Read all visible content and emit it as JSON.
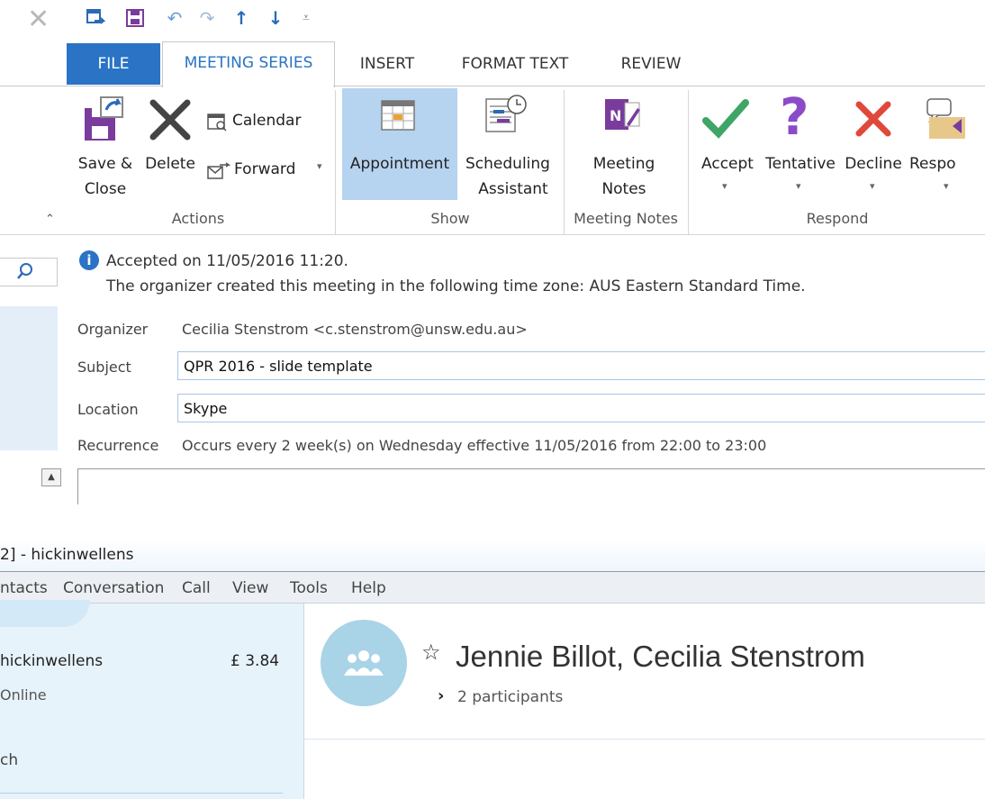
{
  "outlook": {
    "tabs": [
      {
        "label": "FILE"
      },
      {
        "label": "MEETING SERIES"
      },
      {
        "label": "INSERT"
      },
      {
        "label": "FORMAT TEXT"
      },
      {
        "label": "REVIEW"
      }
    ],
    "ribbon": {
      "save_close": "Save &\nClose",
      "save_close_l1": "Save &",
      "save_close_l2": "Close",
      "delete": "Delete",
      "calendar": "Calendar",
      "forward": "Forward",
      "appointment": "Appointment",
      "scheduling_l1": "Scheduling",
      "scheduling_l2": "Assistant",
      "meeting_notes_l1": "Meeting",
      "meeting_notes_l2": "Notes",
      "accept": "Accept",
      "tentative": "Tentative",
      "decline": "Decline",
      "respond": "Respo",
      "groups": {
        "actions": "Actions",
        "show": "Show",
        "meeting_notes": "Meeting Notes",
        "respond": "Respond"
      }
    },
    "info": {
      "accepted": "Accepted on 11/05/2016 11:20.",
      "timezone": "The organizer created this meeting in the following time zone: AUS Eastern Standard Time."
    },
    "form": {
      "organizer_label": "Organizer",
      "organizer_value": "Cecilia Stenstrom <c.stenstrom@unsw.edu.au>",
      "subject_label": "Subject",
      "subject_value": "QPR 2016 - slide template",
      "location_label": "Location",
      "location_value": "Skype",
      "recurrence_label": "Recurrence",
      "recurrence_value": "Occurs every 2 week(s) on Wednesday effective 11/05/2016 from 22:00 to 23:00"
    }
  },
  "skype": {
    "title": "2] - hickinwellens",
    "menu": [
      "ntacts",
      "Conversation",
      "Call",
      "View",
      "Tools",
      "Help"
    ],
    "profile": {
      "name": "hickinwellens",
      "credit": "£ 3.84",
      "status": "Online",
      "search_fragment": "ch"
    },
    "conversation": {
      "title": "Jennie Billot, Cecilia Stenstrom",
      "participants": "2 participants"
    }
  },
  "colors": {
    "accent": "#2a73c5",
    "show_highlight": "#b6d3f0",
    "accept_green": "#3fa566",
    "tentative_purple": "#8b4bc8",
    "decline_red": "#e0483b",
    "avatar_bg": "#a9d3e6"
  }
}
